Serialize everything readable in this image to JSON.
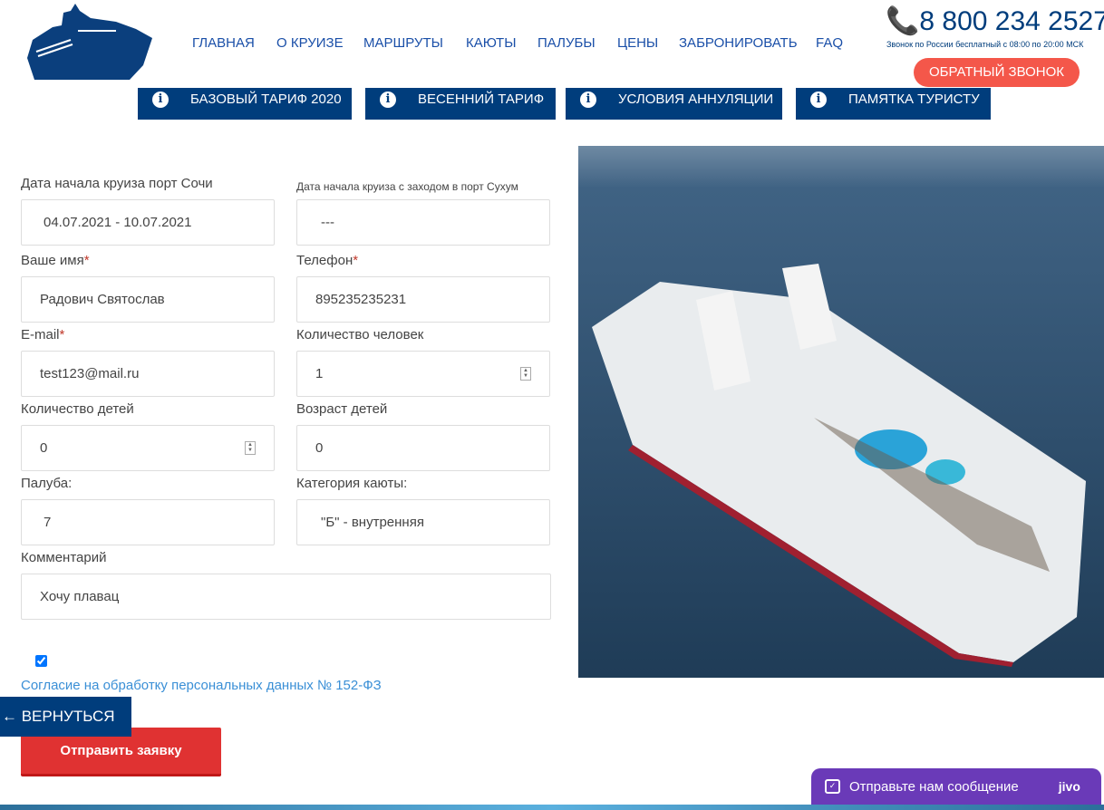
{
  "header": {
    "nav": [
      "ГЛАВНАЯ",
      "О КРУИЗЕ",
      "МАРШРУТЫ",
      "КАЮТЫ",
      "ПАЛУБЫ",
      "ЦЕНЫ",
      "ЗАБРОНИРОВАТЬ",
      "FAQ"
    ],
    "phone": "8 800 234 2527",
    "phone_note": "Звонок по России бесплатный с 08:00 по 20:00 МСК",
    "callback": "ОБРАТНЫЙ ЗВОНОК"
  },
  "tabs": [
    "БАЗОВЫЙ ТАРИФ 2020",
    "ВЕСЕННИЙ ТАРИФ",
    "УСЛОВИЯ АННУЛЯЦИИ",
    "ПАМЯТКА ТУРИСТУ"
  ],
  "form": {
    "start_sochi": {
      "label": "Дата начала круиза порт Сочи",
      "value": "04.07.2021 - 10.07.2021"
    },
    "start_sukhum": {
      "label": "Дата начала круиза с заходом в порт Сухум",
      "value": "---"
    },
    "name": {
      "label": "Ваше имя",
      "value": "Радович Святослав"
    },
    "phone": {
      "label": "Телефон",
      "value": "895235235231"
    },
    "email": {
      "label": "E-mail",
      "value": "test123@mail.ru"
    },
    "people": {
      "label": "Количество человек",
      "value": "1"
    },
    "children": {
      "label": "Количество детей",
      "value": "0"
    },
    "children_age": {
      "label": "Возраст детей",
      "value": "0"
    },
    "deck": {
      "label": "Палуба:",
      "value": "7"
    },
    "cabin": {
      "label": "Категория каюты:",
      "value": "\"Б\" - внутренняя"
    },
    "comment": {
      "label": "Комментарий",
      "value": "Хочу плавац"
    },
    "consent_checked": true,
    "consent": "Согласие на обработку персональных данных № 152-ФЗ",
    "submit": "Отправить заявку"
  },
  "back": "← ВЕРНУТЬСЯ",
  "chat": {
    "label": "Отправьте нам сообщение",
    "brand": "jivo"
  },
  "colors": {
    "primary": "#003d7c",
    "accent": "#e03232",
    "callback": "#f4574a",
    "chat": "#6a3ab8"
  }
}
